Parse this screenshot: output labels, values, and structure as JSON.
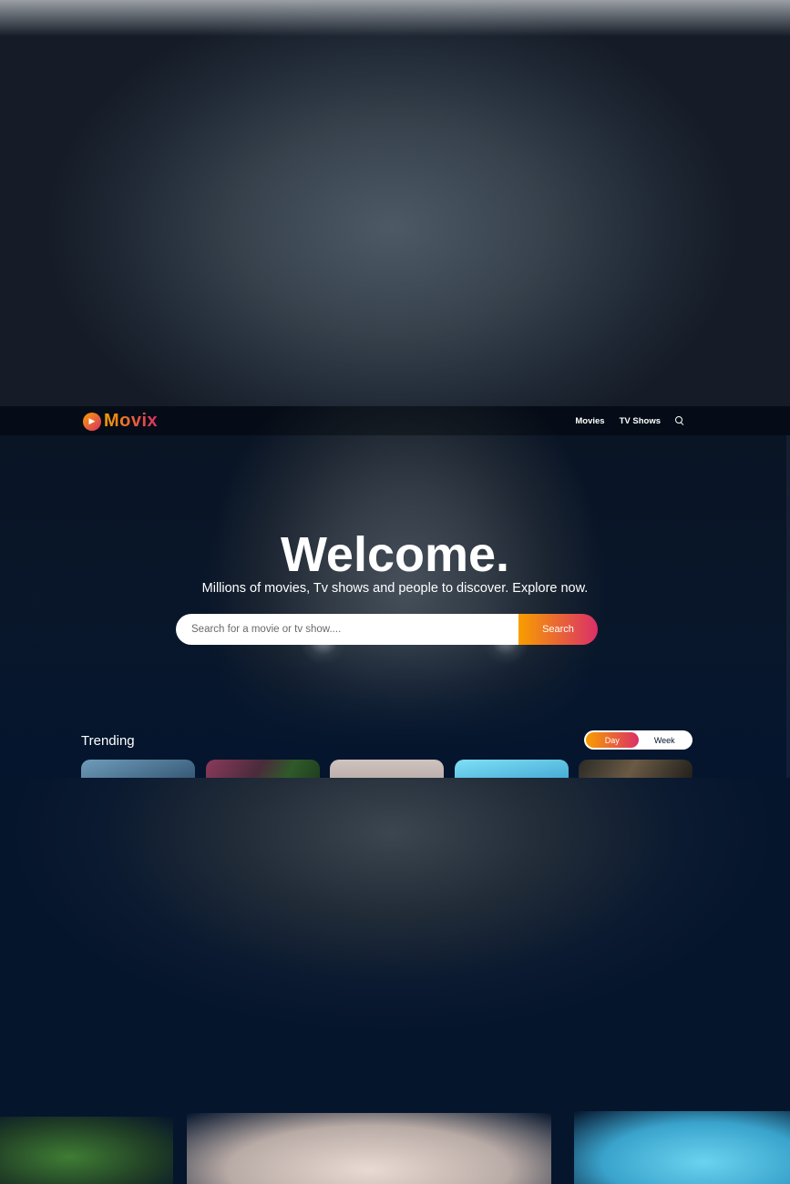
{
  "header": {
    "logo_text": "Movix",
    "logo_mark": "🎬",
    "nav": [
      {
        "label": "Movies"
      },
      {
        "label": "TV Shows"
      }
    ],
    "search_icon": "search-icon"
  },
  "hero": {
    "title": "Welcome.",
    "subtitle": "Millions of movies, Tv shows and people to discover. Explore now.",
    "search_placeholder": "Search for a movie or tv show....",
    "search_button": "Search"
  },
  "trending": {
    "title": "Trending",
    "tabs": [
      {
        "label": "Day",
        "active": true
      },
      {
        "label": "Week",
        "active": false
      }
    ],
    "cards": 5
  },
  "colors": {
    "background": "#04152d",
    "accent_start": "#f89e00",
    "accent_end": "#da2f68"
  }
}
